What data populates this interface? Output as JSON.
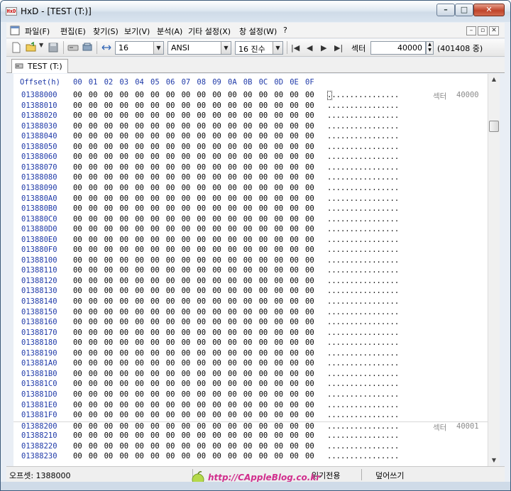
{
  "window": {
    "title": "HxD - [TEST (T:)]",
    "app_icon_text": "HxD"
  },
  "menu": {
    "items": [
      "파일(F)",
      "편집(E)",
      "찾기(S)",
      "보기(V)",
      "분석(A)",
      "기타 설정(X)",
      "창 설정(W)",
      "?"
    ]
  },
  "toolbar": {
    "bytes_per_row": "16",
    "charset": "ANSI",
    "offset_base": "16 진수",
    "sector_label": "섹터",
    "sector_value": "40000",
    "sector_count": "(401408 중)"
  },
  "tab": {
    "label": "TEST (T:)"
  },
  "hex": {
    "offset_header": "Offset(h)",
    "columns": [
      "00",
      "01",
      "02",
      "03",
      "04",
      "05",
      "06",
      "07",
      "08",
      "09",
      "0A",
      "0B",
      "0C",
      "0D",
      "0E",
      "0F"
    ],
    "offsets": [
      "01388000",
      "01388010",
      "01388020",
      "01388030",
      "01388040",
      "01388050",
      "01388060",
      "01388070",
      "01388080",
      "01388090",
      "013880A0",
      "013880B0",
      "013880C0",
      "013880D0",
      "013880E0",
      "013880F0",
      "01388100",
      "01388110",
      "01388120",
      "01388130",
      "01388140",
      "01388150",
      "01388160",
      "01388170",
      "01388180",
      "01388190",
      "013881A0",
      "013881B0",
      "013881C0",
      "013881D0",
      "013881E0",
      "013881F0",
      "01388200",
      "01388210",
      "01388220",
      "01388230"
    ],
    "byte_value": "00",
    "text_value": "................",
    "sector_marker": "섹터",
    "sector_marks": [
      {
        "row": 0,
        "number": "40000"
      },
      {
        "row": 32,
        "number": "40001"
      }
    ]
  },
  "status": {
    "offset": "오프셋: 1388000",
    "mode": "읽기전용",
    "write_mode": "덮어쓰기"
  },
  "watermark": {
    "text": "http://CAppleBlog.co.kr"
  }
}
